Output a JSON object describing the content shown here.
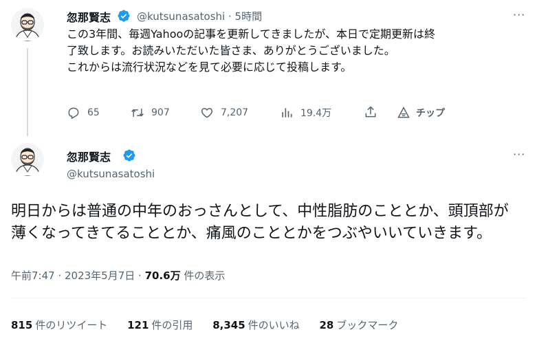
{
  "tweet1": {
    "name": "忽那賢志",
    "handle": "@kutsunasatoshi",
    "separator": "·",
    "time": "5時間",
    "text_lines": [
      "この3年間、毎週Yahooの記事を更新してきましたが、本日で定期更新は終",
      "了致します。お読みいただいた皆さま、ありがとうございました。",
      "これからは流行状況などを見て必要に応じて投稿します。"
    ],
    "actions": {
      "replies": "65",
      "retweets": "907",
      "likes": "7,207",
      "views": "19.4万",
      "tip": "チップ"
    },
    "more": "···"
  },
  "tweet2": {
    "name": "忽那賢志",
    "handle": "@kutsunasatoshi",
    "text_lines": [
      "明日からは普通の中年のおっさんとして、中性脂肪のこととか、頭頂部が",
      "薄くなってきてることとか、痛風のこととかをつぶやいいていきます。"
    ],
    "timestamp": "午前7:47 · 2023年5月7日 ·",
    "views_count": "70.6万",
    "views_label": "件の表示",
    "more": "···"
  },
  "stats": [
    {
      "count": "815",
      "label": "件のリツイート"
    },
    {
      "count": "121",
      "label": "件の引用"
    },
    {
      "count": "8,345",
      "label": "件のいいね"
    },
    {
      "count": "28",
      "label": "ブックマーク"
    }
  ],
  "colors": {
    "verified": "#1d9bf0",
    "muted": "#536471",
    "text": "#0f1419"
  }
}
